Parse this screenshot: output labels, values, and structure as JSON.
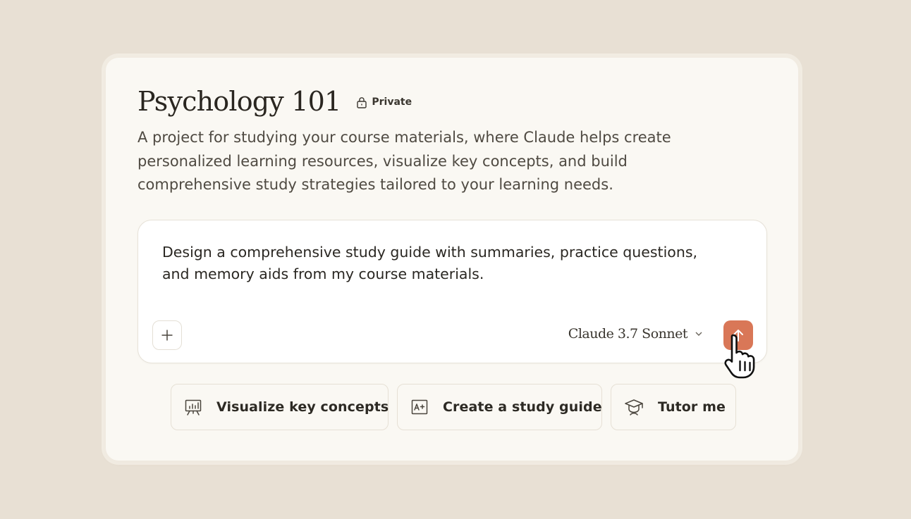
{
  "project": {
    "title": "Psychology 101",
    "visibility_label": "Private",
    "visibility_icon": "lock-icon",
    "description": "A project for studying your course materials, where Claude helps create personalized learning resources, visualize key concepts, and build comprehensive study strategies tailored to your learning needs."
  },
  "composer": {
    "input_text": "Design a comprehensive study guide with summaries, practice questions, and memory aids from my course materials.",
    "add_icon": "plus-icon",
    "model_label": "Claude 3.7 Sonnet",
    "model_icon": "chevron-down-icon",
    "send_icon": "arrow-up-icon",
    "send_color": "#d97757"
  },
  "suggestions": [
    {
      "label": "Visualize key concepts",
      "icon": "presentation-chart-icon"
    },
    {
      "label": "Create a study guide",
      "icon": "grade-document-icon"
    },
    {
      "label": "Tutor me",
      "icon": "graduation-cap-icon"
    }
  ],
  "colors": {
    "background": "#e8e0d4",
    "card": "#faf8f3",
    "accent": "#d97757"
  }
}
